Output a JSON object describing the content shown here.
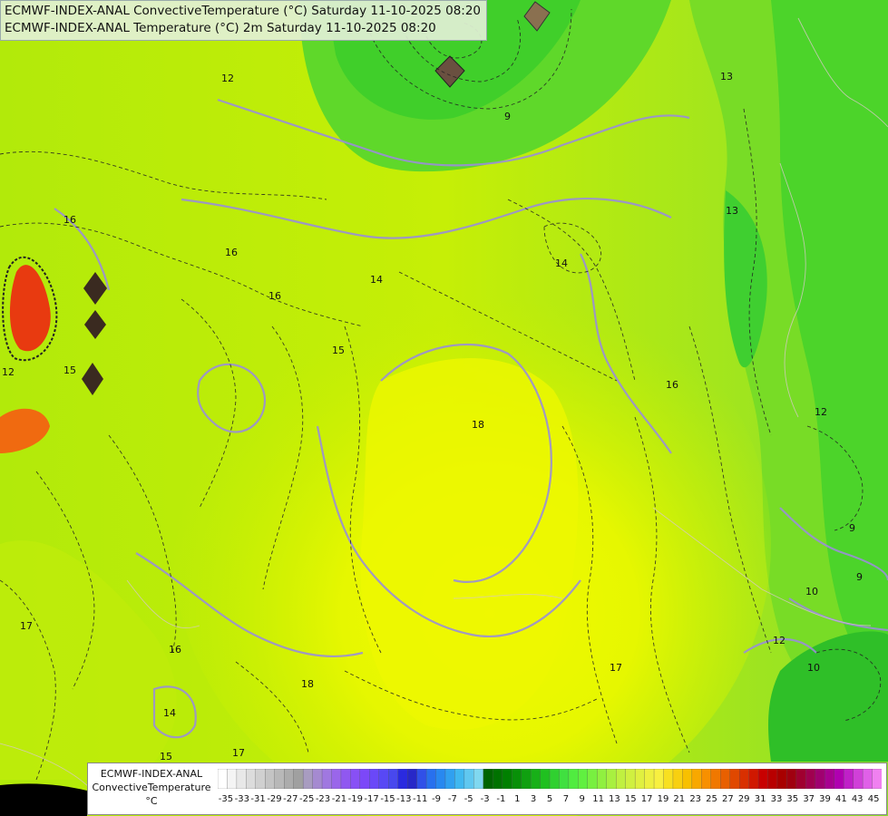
{
  "header": {
    "line1": "ECMWF-INDEX-ANAL ConvectiveTemperature (°C) Saturday 11-10-2025 08:20",
    "line2": "ECMWF-INDEX-ANAL Temperature (°C) 2m Saturday 11-10-2025 08:20"
  },
  "legend": {
    "title": "ECMWF-INDEX-ANAL",
    "variable": "ConvectiveTemperature",
    "unit": "°C",
    "ticks": [
      "-35",
      "-33",
      "-31",
      "-29",
      "-27",
      "-25",
      "-23",
      "-21",
      "-19",
      "-17",
      "-15",
      "-13",
      "-11",
      "-9",
      "-7",
      "-5",
      "-3",
      "-1",
      "1",
      "3",
      "5",
      "7",
      "9",
      "11",
      "13",
      "15",
      "17",
      "19",
      "21",
      "23",
      "25",
      "27",
      "29",
      "31",
      "33",
      "35",
      "37",
      "39",
      "41",
      "43",
      "45"
    ],
    "colors": [
      "#ffffff",
      "#f4f4f4",
      "#e8e8e8",
      "#dcdcdc",
      "#d0d0d0",
      "#c4c4c4",
      "#b8b8b8",
      "#acacac",
      "#a0a0a0",
      "#a89cc0",
      "#a58ad0",
      "#a078e0",
      "#9a66ea",
      "#9058f0",
      "#8850f5",
      "#7c48f8",
      "#6a48f8",
      "#5848f5",
      "#4848ee",
      "#2a2ae0",
      "#2828c8",
      "#3050e8",
      "#2870ee",
      "#2888f0",
      "#30a0f0",
      "#40b8f0",
      "#60c8f0",
      "#80d8f0",
      "#006400",
      "#007200",
      "#008000",
      "#089008",
      "#10a010",
      "#18b018",
      "#20c020",
      "#30d030",
      "#40e040",
      "#50ec40",
      "#60f040",
      "#78f040",
      "#90f040",
      "#a8f040",
      "#c0f040",
      "#d0f040",
      "#e0f040",
      "#eef040",
      "#f8f040",
      "#f8e020",
      "#f8d010",
      "#f8c000",
      "#f8a800",
      "#f89000",
      "#f07800",
      "#e86000",
      "#e04800",
      "#d83000",
      "#d01800",
      "#c80000",
      "#b80000",
      "#a80000",
      "#a00010",
      "#a00030",
      "#a00050",
      "#a00070",
      "#a80090",
      "#b000b0",
      "#c020c8",
      "#d040d8",
      "#e060e8",
      "#f080f0"
    ]
  },
  "map": {
    "contour_labels": [
      "12",
      "9",
      "13",
      "16",
      "14",
      "15",
      "17",
      "18",
      "12",
      "10",
      "9",
      "13",
      "16",
      "14",
      "15",
      "16",
      "16",
      "17",
      "18",
      "17",
      "12",
      "10",
      "15",
      "16",
      "14",
      "12",
      "9"
    ]
  }
}
